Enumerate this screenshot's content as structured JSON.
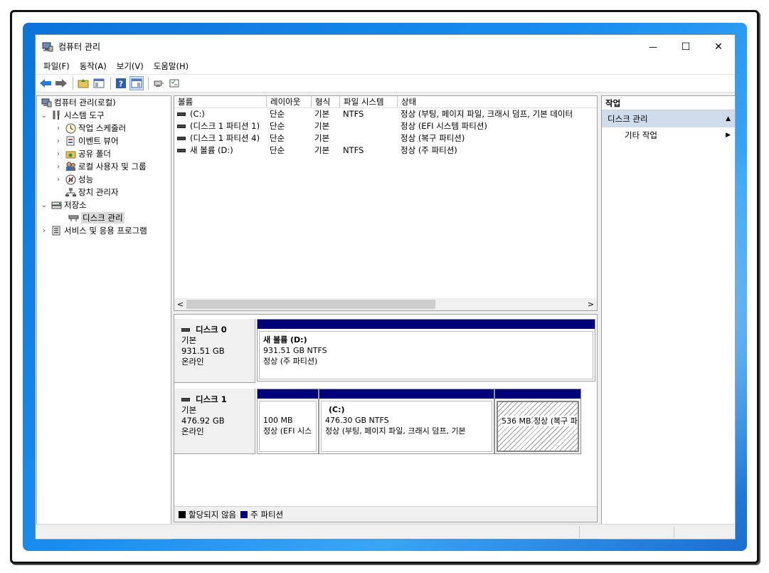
{
  "window": {
    "title": "컴퓨터 관리",
    "controls": {
      "minimize": "—",
      "maximize": "☐",
      "close": "✕"
    }
  },
  "menubar": [
    "파일(F)",
    "동작(A)",
    "보기(V)",
    "도움말(H)"
  ],
  "toolbar": {
    "icons": [
      "back-arrow-icon",
      "forward-arrow-icon",
      "up-folder-icon",
      "show-hide-tree-icon",
      "help-icon",
      "action-pane-icon",
      "connect-icon",
      "properties-icon"
    ]
  },
  "tree": {
    "root": "컴퓨터 관리(로컬)",
    "system_tools": "시스템 도구",
    "task_scheduler": "작업 스케줄러",
    "event_viewer": "이벤트 뷰어",
    "shared_folders": "공유 폴더",
    "local_users": "로컬 사용자 및 그룹",
    "performance": "성능",
    "device_manager": "장치 관리자",
    "storage": "저장소",
    "disk_management": "디스크 관리",
    "services_apps": "서비스 및 응용 프로그램"
  },
  "volumes": {
    "columns": [
      "볼륨",
      "레이아웃",
      "형식",
      "파일 시스템",
      "상태"
    ],
    "rows": [
      {
        "volume": "(C:)",
        "layout": "단순",
        "type": "기본",
        "fs": "NTFS",
        "status": "정상 (부팅, 페이지 파일, 크래시 덤프, 기본 데이터"
      },
      {
        "volume": "(디스크 1 파티션 1)",
        "layout": "단순",
        "type": "기본",
        "fs": "",
        "status": "정상 (EFI 시스템 파티션)"
      },
      {
        "volume": "(디스크 1 파티션 4)",
        "layout": "단순",
        "type": "기본",
        "fs": "",
        "status": "정상 (복구 파티션)"
      },
      {
        "volume": "새 볼륨 (D:)",
        "layout": "단순",
        "type": "기본",
        "fs": "NTFS",
        "status": "정상 (주 파티션)"
      }
    ],
    "scroll_left": "<",
    "scroll_right": ">"
  },
  "disks": [
    {
      "name": "디스크 0",
      "kind": "기본",
      "size": "931.51 GB",
      "state": "온라인",
      "partitions": [
        {
          "title": "새 볼륨  (D:)",
          "line1": "931.51 GB NTFS",
          "line2": "정상 (주 파티션)"
        }
      ]
    },
    {
      "name": "디스크 1",
      "kind": "기본",
      "size": "476.92 GB",
      "state": "온라인",
      "partitions": [
        {
          "title": "",
          "line1": "100 MB",
          "line2": "정상 (EFI 시스"
        },
        {
          "title": "(C:)",
          "line1": "476.30 GB NTFS",
          "line2": "정상 (부팅, 페이지 파일, 크래시 덤프, 기본"
        },
        {
          "title": "",
          "line1": "536 MB",
          "line2": "정상 (복구 파티션)"
        }
      ]
    }
  ],
  "legend": {
    "unallocated": "할당되지 않음",
    "primary": "주 파티션",
    "unallocated_color": "#000000",
    "primary_color": "#00007a"
  },
  "actions": {
    "header": "작업",
    "section": "디스크 관리",
    "more": "기타 작업"
  }
}
